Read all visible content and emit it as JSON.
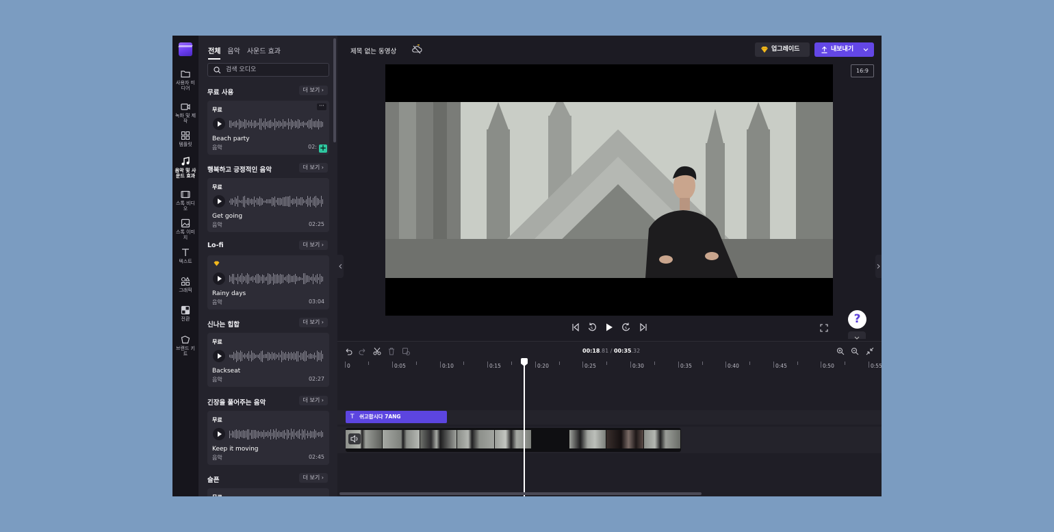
{
  "rail": {
    "items": [
      {
        "label": "사용자 미디어",
        "icon": "folder-icon"
      },
      {
        "label": "녹화 및 제작",
        "icon": "camera-icon"
      },
      {
        "label": "템플릿",
        "icon": "templates-icon"
      },
      {
        "label": "음악 및 사운드 효과",
        "icon": "music-icon"
      },
      {
        "label": "스톡 비디오",
        "icon": "film-icon"
      },
      {
        "label": "스톡 이미지",
        "icon": "image-icon"
      },
      {
        "label": "텍스트",
        "icon": "text-icon"
      },
      {
        "label": "그래픽",
        "icon": "graphics-icon"
      },
      {
        "label": "전환",
        "icon": "transitions-icon"
      },
      {
        "label": "브랜드 키트",
        "icon": "brand-kit-icon"
      }
    ]
  },
  "panel": {
    "tabs": [
      "전체",
      "음악",
      "사운드 효과"
    ],
    "search_placeholder": "검색 오디오",
    "more_label": "더 보기",
    "sections": [
      {
        "title": "무료 사용",
        "badge": "무료",
        "name": "Beach party",
        "kind": "음악",
        "duration": "02:"
      },
      {
        "title": "행복하고 긍정적인 음악",
        "badge": "무료",
        "name": "Get going",
        "kind": "음악",
        "duration": "02:25"
      },
      {
        "title": "Lo-fi",
        "badge": "",
        "name": "Rainy days",
        "kind": "음악",
        "duration": "03:04"
      },
      {
        "title": "신나는 힙합",
        "badge": "무료",
        "name": "Backseat",
        "kind": "음악",
        "duration": "02:27"
      },
      {
        "title": "긴장을 풀어주는 음악",
        "badge": "무료",
        "name": "Keep it moving",
        "kind": "음악",
        "duration": "02:45"
      },
      {
        "title": "슬픈",
        "badge": "무료",
        "name": "",
        "kind": "",
        "duration": ""
      }
    ]
  },
  "header": {
    "project_title": "제목 없는 동영상",
    "upgrade_label": "업그레이드",
    "export_label": "내보내기",
    "aspect_ratio": "16:9"
  },
  "help": {
    "label": "?"
  },
  "timeline": {
    "current_time": "00:18",
    "current_frac": ".81",
    "separator": " / ",
    "total_time": "00:35",
    "total_frac": ".32",
    "ruler_labels": [
      "0",
      "0:05",
      "0:10",
      "0:15",
      "0:20",
      "0:25",
      "0:30",
      "0:35",
      "0:40",
      "0:45",
      "0:50",
      "0:55"
    ],
    "text_clip_label": "쉬고합시다 7ANG",
    "text_clip_icon": "T"
  },
  "colors": {
    "accent": "#6347e6",
    "add": "#2fc7a0",
    "premium": "#f2b81c"
  }
}
